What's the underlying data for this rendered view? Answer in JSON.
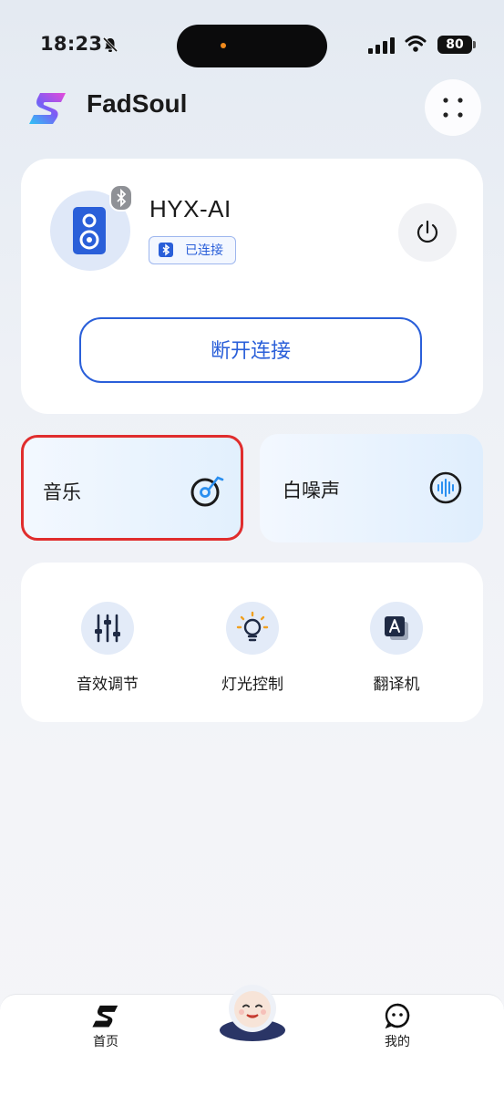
{
  "status_bar": {
    "time": "18:23",
    "battery": "80"
  },
  "header": {
    "app_name": "FadSoul"
  },
  "device": {
    "name": "HYX-AI",
    "status": "已连接",
    "disconnect_label": "断开连接"
  },
  "features": [
    {
      "label": "音乐",
      "icon": "music-disc-icon"
    },
    {
      "label": "白噪声",
      "icon": "sound-wave-icon"
    }
  ],
  "tools": [
    {
      "label": "音效调节",
      "icon": "equalizer-icon"
    },
    {
      "label": "灯光控制",
      "icon": "light-bulb-icon"
    },
    {
      "label": "翻译机",
      "icon": "translate-icon"
    }
  ],
  "tabbar": [
    {
      "label": "首页",
      "icon": "fadsoul-logo-icon"
    },
    {
      "label": "我的",
      "icon": "profile-face-icon"
    }
  ],
  "colors": {
    "accent": "#2a5fd9",
    "highlight": "#e02d2d"
  }
}
